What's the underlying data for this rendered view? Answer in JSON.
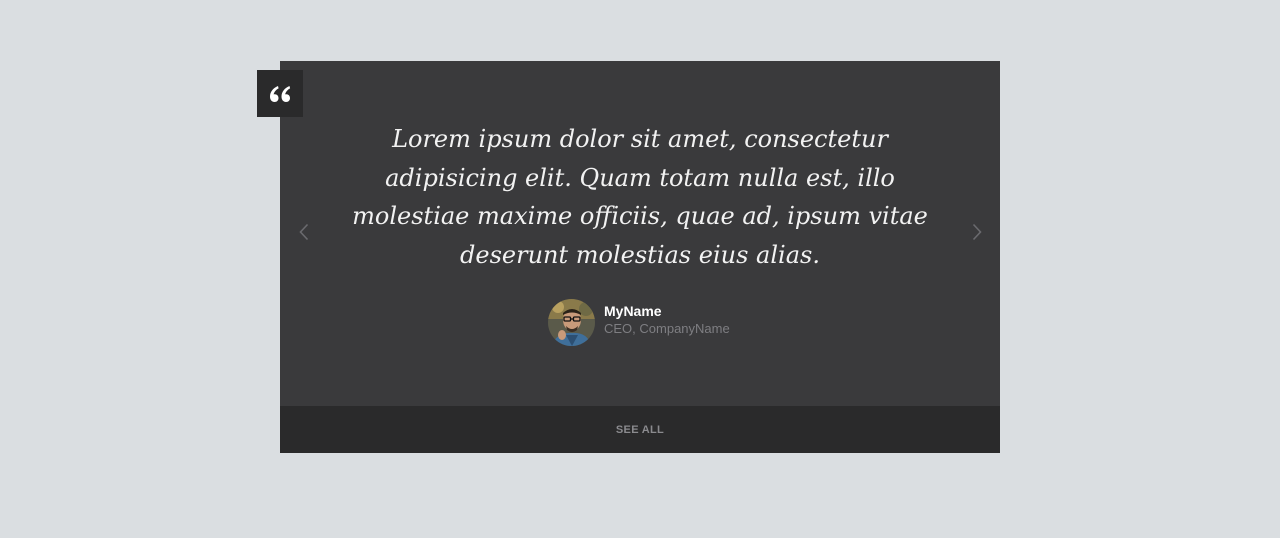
{
  "testimonial": {
    "quote": "Lorem ipsum dolor sit amet, consectetur adipisicing elit. Quam totam nulla est, illo molestiae maxime officiis, quae ad, ipsum vitae deserunt molestias eius alias.",
    "author_name": "MyName",
    "author_role": "CEO, CompanyName"
  },
  "icons": {
    "quote": "quote-icon",
    "prev": "chevron-left-icon",
    "next": "chevron-right-icon"
  },
  "footer": {
    "see_all_label": "SEE ALL"
  },
  "colors": {
    "page_background": "#dadee1",
    "card_background": "#3a3a3c",
    "footer_background": "#2a2a2b",
    "quote_text": "#f2f2f2",
    "muted_text": "#7e7e82"
  }
}
